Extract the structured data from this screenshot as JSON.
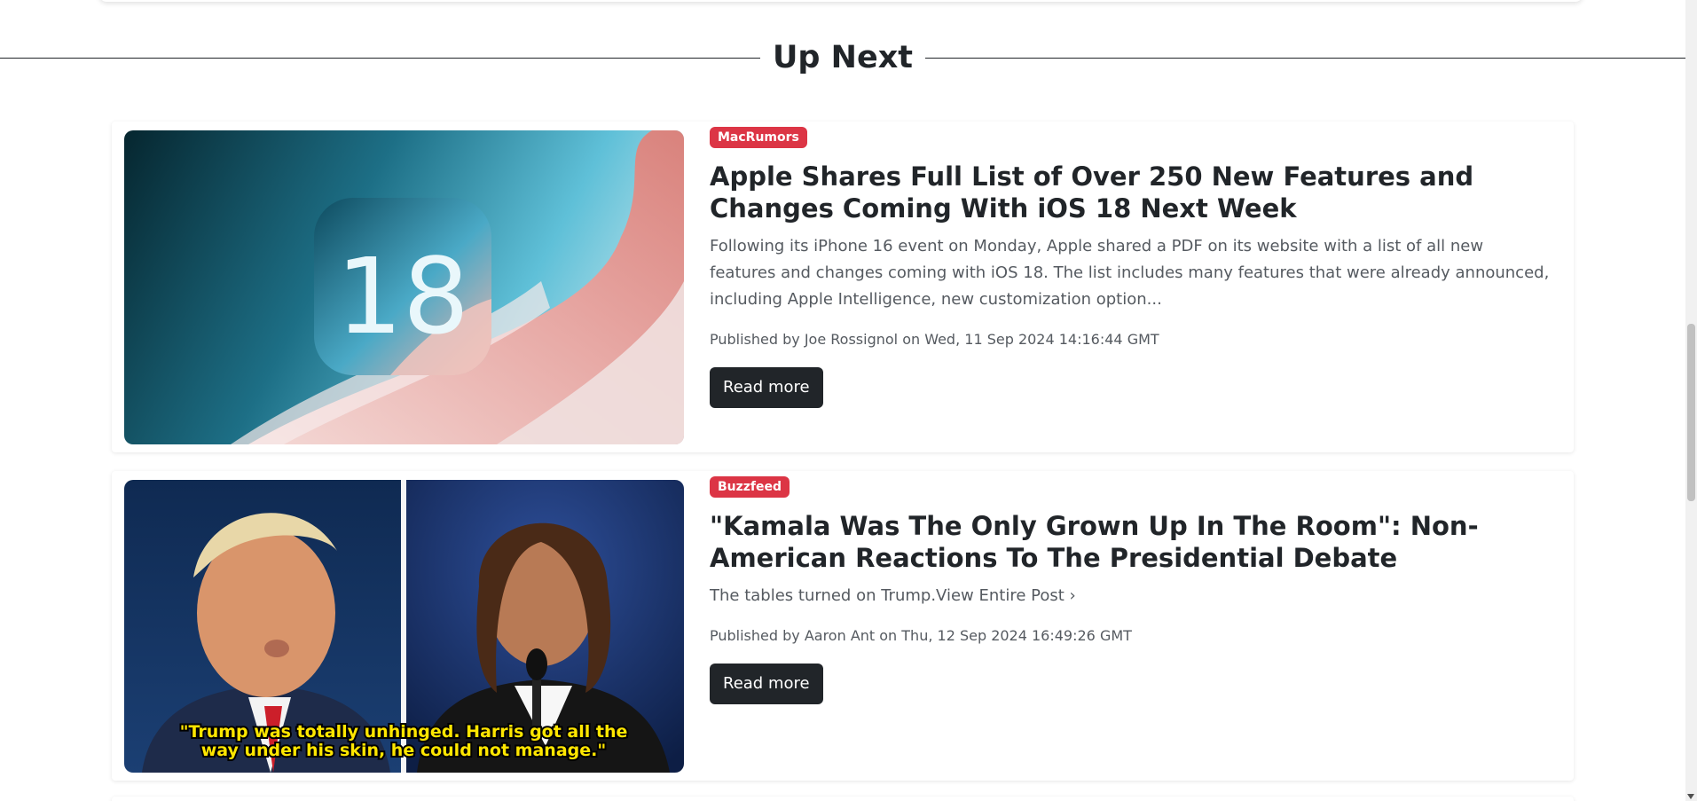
{
  "section": {
    "heading": "Up Next"
  },
  "articles": [
    {
      "source": "MacRumors",
      "title": "Apple Shares Full List of Over 250 New Features and Changes Coming With iOS 18 Next Week",
      "summary": "Following its iPhone 16 event on Monday, Apple shared a PDF on its website with a list of all new features and changes coming with iOS 18. The list includes many features that were already announced, including Apple Intelligence, new customization option...",
      "byline": "Published by Joe Rossignol on Wed, 11 Sep 2024 14:16:44 GMT",
      "button_label": "Read more",
      "image_text": "18"
    },
    {
      "source": "Buzzfeed",
      "title": "\"Kamala Was The Only Grown Up In The Room\": Non-American Reactions To The Presidential Debate",
      "summary": "The tables turned on Trump.View Entire Post ›",
      "byline": "Published by Aaron Ant on Thu, 12 Sep 2024 16:49:26 GMT",
      "button_label": "Read more",
      "image_caption": "\"Trump was totally unhinged. Harris got all the way under his skin, he could not manage.\""
    }
  ],
  "colors": {
    "badge": "#dc3545",
    "button": "#212529",
    "text": "#212529",
    "muted": "#555a60"
  }
}
